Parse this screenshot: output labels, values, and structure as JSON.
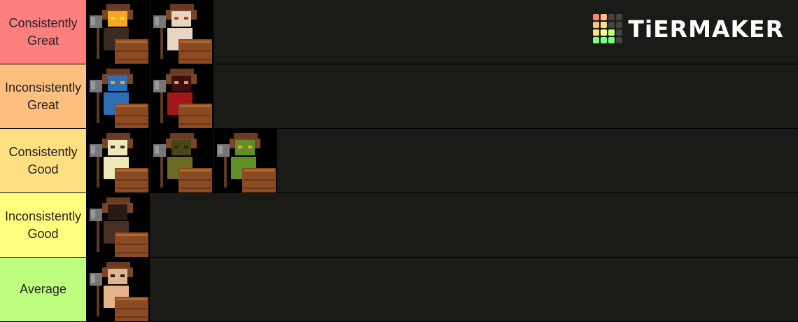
{
  "logo": {
    "text": "TiERMAKER",
    "grid_colors": [
      "#ff7f7f",
      "#ffbf7f",
      "#444444",
      "#444444",
      "#ffbf7f",
      "#ffdf7f",
      "#444444",
      "#444444",
      "#ffdf7f",
      "#ffff7f",
      "#bfff7f",
      "#444444",
      "#7fff7f",
      "#7fff7f",
      "#7fff7f",
      "#444444"
    ]
  },
  "tiers": [
    {
      "label": "Consistently Great",
      "color": "#ff7f7f",
      "items": [
        {
          "name": "torch-head-character",
          "skin": "#3a2a1f",
          "face": "#f5a623",
          "eyes": "#ffdd33"
        },
        {
          "name": "pale-vampire-character",
          "skin": "#e6d5c0",
          "face": "#e6d5c0",
          "eyes": "#d63030"
        }
      ]
    },
    {
      "label": "Inconsistently Great",
      "color": "#ffbf7f",
      "items": [
        {
          "name": "blue-character",
          "skin": "#2f6db5",
          "face": "#2f6db5",
          "eyes": "#f0a020"
        },
        {
          "name": "red-demon-character",
          "skin": "#a01818",
          "face": "#3a1010",
          "eyes": "#f0a020"
        }
      ]
    },
    {
      "label": "Consistently Good",
      "color": "#ffdf7f",
      "items": [
        {
          "name": "skeleton-character",
          "skin": "#efe7b8",
          "face": "#efe7b8",
          "eyes": "#333333"
        },
        {
          "name": "rotten-zombie-character",
          "skin": "#6b6a25",
          "face": "#4a4418",
          "eyes": "#2a2a10"
        },
        {
          "name": "green-goblin-character",
          "skin": "#5f8f25",
          "face": "#5f8f25",
          "eyes": "#f0a020"
        }
      ]
    },
    {
      "label": "Inconsistently Good",
      "color": "#ffff7f",
      "items": [
        {
          "name": "shadow-character",
          "skin": "#4a2e22",
          "face": "#2a1a14",
          "eyes": "#2a1a14"
        }
      ]
    },
    {
      "label": "Average",
      "color": "#bfff7f",
      "items": [
        {
          "name": "bearded-human-character",
          "skin": "#e3b48c",
          "face": "#e3b48c",
          "eyes": "#222222"
        }
      ]
    }
  ]
}
